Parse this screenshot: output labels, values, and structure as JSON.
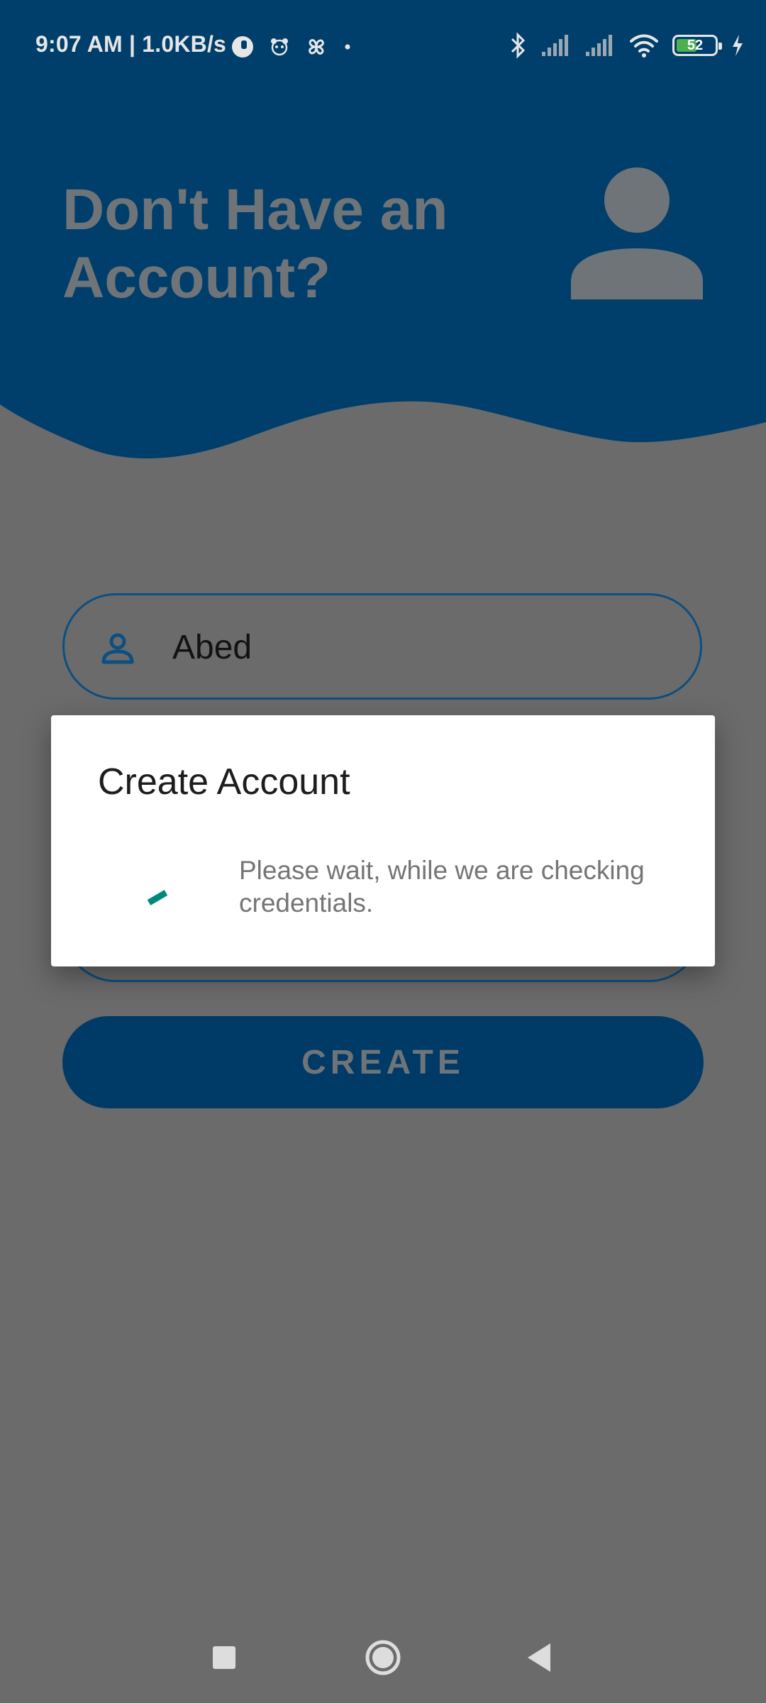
{
  "status_bar": {
    "time_and_speed": "9:07 AM | 1.0KB/s",
    "battery_level": "52",
    "icons": [
      "circle-app-icon",
      "panda-icon",
      "pinwheel-icon",
      "dot-icon",
      "bluetooth-icon",
      "signal-icon",
      "signal-icon",
      "wifi-icon",
      "battery-icon",
      "charging-icon"
    ]
  },
  "header": {
    "title": "Don't Have an Account?",
    "icon": "person-icon",
    "color": "#003f6b"
  },
  "form": {
    "name_value": "Abed",
    "name_icon": "person-outline-icon",
    "create_label": "CREATE"
  },
  "dialog": {
    "title": "Create Account",
    "message": "Please wait, while we are checking credentials.",
    "spinner_color": "#00897b"
  },
  "nav_bar": {
    "icons": [
      "recent-apps-icon",
      "home-icon",
      "back-icon"
    ]
  }
}
